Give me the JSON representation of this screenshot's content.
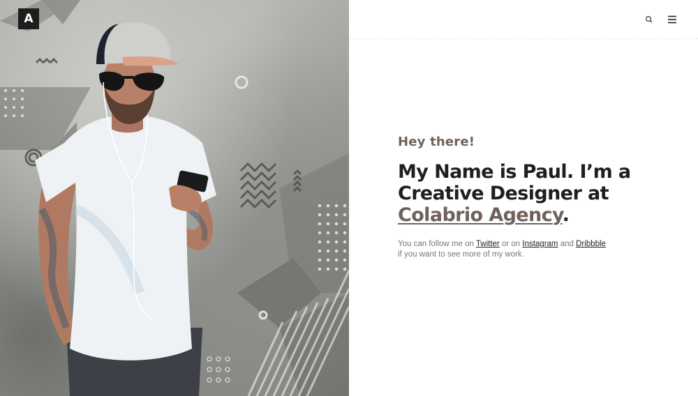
{
  "brand": {
    "logo_letter": "A"
  },
  "header": {
    "search_icon": "search-icon",
    "menu_icon": "hamburger-menu-icon"
  },
  "hero": {
    "image_subject": "man in white t-shirt with cap and sunglasses looking at phone",
    "colors": {
      "concrete": "#a9a9a5",
      "shirt": "#eef2f5",
      "cap": "#cfcfcc",
      "cap_brim": "#d9a28a"
    }
  },
  "intro": {
    "greeting": "Hey there!",
    "headline_part1": "My Name is Paul. I’m a Creative Designer at ",
    "agency_link": "Colabrio Agency",
    "headline_end": ".",
    "follow_prefix": "You can follow me on ",
    "twitter": "Twitter",
    "follow_or": " or on ",
    "instagram": "Instagram",
    "follow_and": " and ",
    "dribbble": "Dribbble",
    "follow_suffix": "if you want to see more of my work."
  },
  "colors": {
    "accent": "#6f625a",
    "text_dark": "#1f1f1f",
    "text_muted": "#777777",
    "logo_bg": "#1d1d1d"
  }
}
